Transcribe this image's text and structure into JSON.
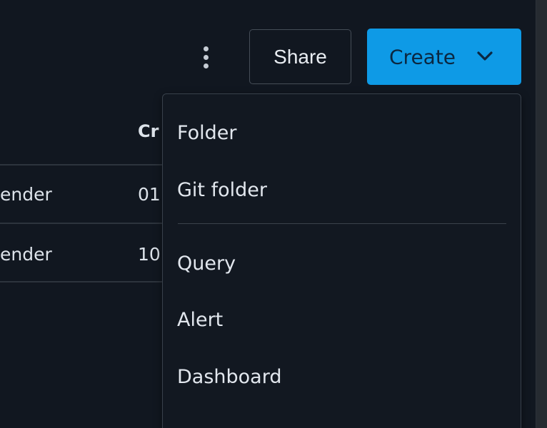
{
  "toolbar": {
    "share_label": "Share",
    "create_label": "Create",
    "more_icon": "kebab-vertical-icon",
    "create_dropdown_icon": "chevron-down-icon"
  },
  "table": {
    "visible_header": "Cr",
    "rows": [
      {
        "name": "ender",
        "created": "01"
      },
      {
        "name": "ender",
        "created": "10"
      }
    ]
  },
  "create_menu": {
    "items": [
      {
        "label": "Folder"
      },
      {
        "label": "Git folder"
      },
      {
        "label": "Query"
      },
      {
        "label": "Alert"
      },
      {
        "label": "Dashboard"
      }
    ],
    "partial_item_label": ""
  },
  "colors": {
    "background": "#111720",
    "primary_button": "#0e9ae6",
    "menu_background": "#121821",
    "border": "#39414b",
    "text": "#e2e7ee"
  }
}
